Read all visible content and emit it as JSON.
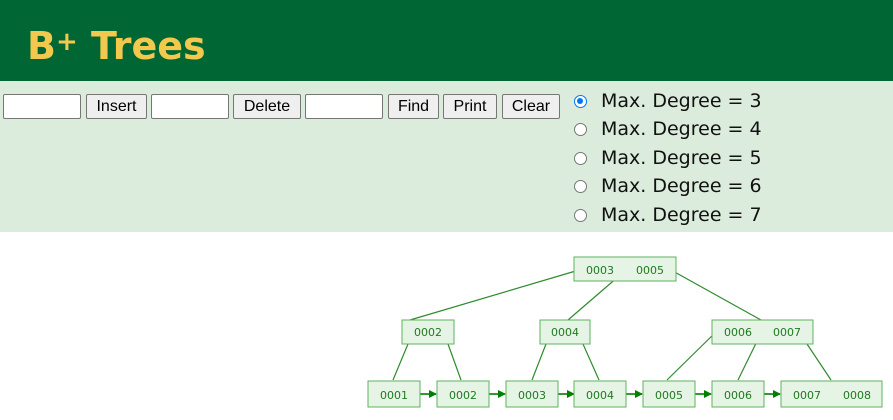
{
  "header": {
    "title": "B",
    "title_sup": "+",
    "title_suffix": " Trees",
    "background": "#006633",
    "title_color": "#f2c94c"
  },
  "controls": {
    "insert_placeholder": "",
    "delete_placeholder": "",
    "find_placeholder": "",
    "insert_label": "Insert",
    "delete_label": "Delete",
    "find_label": "Find",
    "print_label": "Print",
    "clear_label": "Clear",
    "background": "#dcecdc"
  },
  "degree_options": [
    {
      "label": "Max. Degree = 3",
      "selected": true
    },
    {
      "label": "Max. Degree = 4",
      "selected": false
    },
    {
      "label": "Max. Degree = 5",
      "selected": false
    },
    {
      "label": "Max. Degree = 6",
      "selected": false
    },
    {
      "label": "Max. Degree = 7",
      "selected": false
    }
  ],
  "tree": {
    "root": [
      "0003",
      "0005"
    ],
    "internal": [
      [
        "0002"
      ],
      [
        "0004"
      ],
      [
        "0006",
        "0007"
      ]
    ],
    "leaves": [
      [
        "0001"
      ],
      [
        "0002"
      ],
      [
        "0003"
      ],
      [
        "0004"
      ],
      [
        "0005"
      ],
      [
        "0006"
      ],
      [
        "0007",
        "0008"
      ]
    ],
    "colors": {
      "node_fill": "#e6f4e6",
      "node_stroke": "#5db35d",
      "text": "#1f7a1f",
      "link": "#2e8b2e"
    }
  }
}
